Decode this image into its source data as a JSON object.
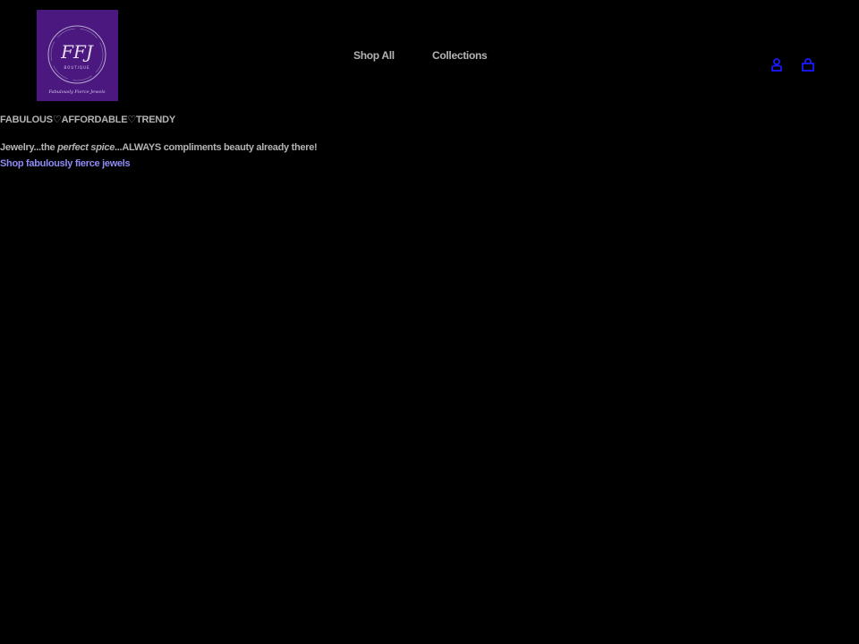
{
  "header": {
    "logo": {
      "monogram": "FFJ",
      "subtitle": "BOUTIQUE",
      "script_text": "Fabulously Fierce Jewels"
    },
    "nav": {
      "shop_all": "Shop All",
      "collections": "Collections"
    },
    "icons": {
      "account": "account-icon",
      "cart": "cart-icon"
    }
  },
  "tagline": {
    "part1": "FABULOUS",
    "heart1": "♡",
    "part2": "AFFORDABLE",
    "heart2": "♡",
    "part3": "TRENDY"
  },
  "hero": {
    "text_before": "Jewelry...the ",
    "text_emphasis": "perfect spice",
    "text_after": "...ALWAYS compliments beauty already there!",
    "link_label": "Shop fabulously fierce jewels"
  },
  "colors": {
    "background": "#000000",
    "logo_background": "#4b1880",
    "text": "#b3b3b3",
    "link": "#8f8bf5",
    "icon": "#1a1aff"
  }
}
